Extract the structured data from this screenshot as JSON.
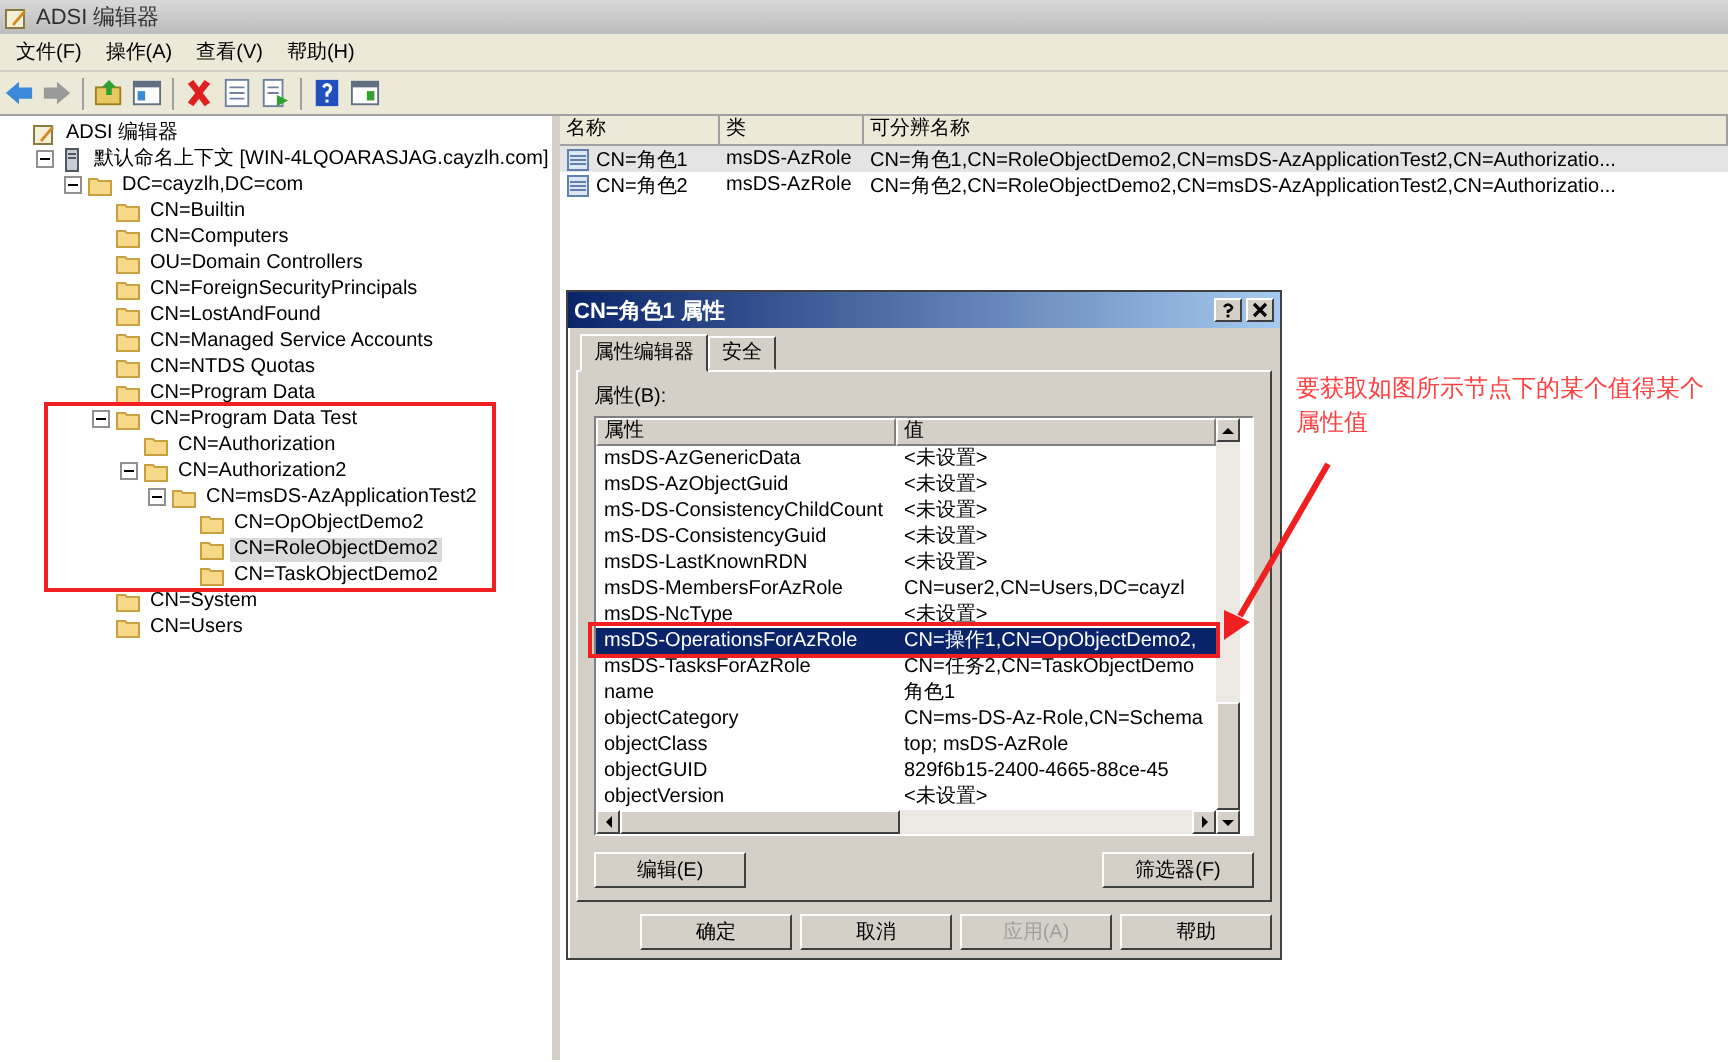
{
  "window": {
    "title": "ADSI 编辑器"
  },
  "menu": [
    "文件(F)",
    "操作(A)",
    "查看(V)",
    "帮助(H)"
  ],
  "tree": [
    {
      "label": "ADSI 编辑器",
      "kind": "root",
      "selected": false,
      "children": [
        {
          "label": "默认命名上下文 [WIN-4LQOARASJAG.cayzlh.com]",
          "kind": "server",
          "selected": false,
          "expanded": true,
          "children": [
            {
              "label": "DC=cayzlh,DC=com",
              "kind": "folder",
              "selected": false,
              "expanded": true,
              "children": [
                {
                  "label": "CN=Builtin",
                  "kind": "folder",
                  "selected": false
                },
                {
                  "label": "CN=Computers",
                  "kind": "folder",
                  "selected": false
                },
                {
                  "label": "OU=Domain Controllers",
                  "kind": "folder",
                  "selected": false
                },
                {
                  "label": "CN=ForeignSecurityPrincipals",
                  "kind": "folder",
                  "selected": false
                },
                {
                  "label": "CN=LostAndFound",
                  "kind": "folder",
                  "selected": false
                },
                {
                  "label": "CN=Managed Service Accounts",
                  "kind": "folder",
                  "selected": false
                },
                {
                  "label": "CN=NTDS Quotas",
                  "kind": "folder",
                  "selected": false
                },
                {
                  "label": "CN=Program Data",
                  "kind": "folder",
                  "selected": false
                },
                {
                  "label": "CN=Program Data Test",
                  "kind": "folder",
                  "selected": false,
                  "expanded": true,
                  "children": [
                    {
                      "label": "CN=Authorization",
                      "kind": "folder",
                      "selected": false
                    },
                    {
                      "label": "CN=Authorization2",
                      "kind": "folder",
                      "selected": false,
                      "expanded": true,
                      "children": [
                        {
                          "label": "CN=msDS-AzApplicationTest2",
                          "kind": "folder",
                          "selected": false,
                          "expanded": true,
                          "children": [
                            {
                              "label": "CN=OpObjectDemo2",
                              "kind": "folder",
                              "selected": false
                            },
                            {
                              "label": "CN=RoleObjectDemo2",
                              "kind": "folder",
                              "selected": true
                            },
                            {
                              "label": "CN=TaskObjectDemo2",
                              "kind": "folder",
                              "selected": false
                            }
                          ]
                        }
                      ]
                    }
                  ]
                },
                {
                  "label": "CN=System",
                  "kind": "folder",
                  "selected": false
                },
                {
                  "label": "CN=Users",
                  "kind": "folder",
                  "selected": false
                }
              ]
            }
          ]
        }
      ]
    }
  ],
  "list": {
    "columns": [
      "名称",
      "类",
      "可分辨名称"
    ],
    "rows": [
      {
        "name": "CN=角色1",
        "class": "msDS-AzRole",
        "dn": "CN=角色1,CN=RoleObjectDemo2,CN=msDS-AzApplicationTest2,CN=Authorizatio...",
        "selected": true
      },
      {
        "name": "CN=角色2",
        "class": "msDS-AzRole",
        "dn": "CN=角色2,CN=RoleObjectDemo2,CN=msDS-AzApplicationTest2,CN=Authorizatio...",
        "selected": false
      }
    ]
  },
  "dialog": {
    "title": "CN=角色1 属性",
    "tabs": [
      {
        "label": "属性编辑器",
        "selected": true
      },
      {
        "label": "安全",
        "selected": false
      }
    ],
    "attributes_label": "属性(B):",
    "columns": [
      "属性",
      "值"
    ],
    "rows": [
      {
        "attribute": "msDS-AzGenericData",
        "value": "<未设置>",
        "selected": false
      },
      {
        "attribute": "msDS-AzObjectGuid",
        "value": "<未设置>",
        "selected": false
      },
      {
        "attribute": "mS-DS-ConsistencyChildCount",
        "value": "<未设置>",
        "selected": false
      },
      {
        "attribute": "mS-DS-ConsistencyGuid",
        "value": "<未设置>",
        "selected": false
      },
      {
        "attribute": "msDS-LastKnownRDN",
        "value": "<未设置>",
        "selected": false
      },
      {
        "attribute": "msDS-MembersForAzRole",
        "value": "CN=user2,CN=Users,DC=cayzl",
        "selected": false
      },
      {
        "attribute": "msDS-NcType",
        "value": "<未设置>",
        "selected": false
      },
      {
        "attribute": "msDS-OperationsForAzRole",
        "value": "CN=操作1,CN=OpObjectDemo2,",
        "selected": true
      },
      {
        "attribute": "msDS-TasksForAzRole",
        "value": "CN=任务2,CN=TaskObjectDemo",
        "selected": false
      },
      {
        "attribute": "name",
        "value": "角色1",
        "selected": false
      },
      {
        "attribute": "objectCategory",
        "value": "CN=ms-DS-Az-Role,CN=Schema",
        "selected": false
      },
      {
        "attribute": "objectClass",
        "value": "top; msDS-AzRole",
        "selected": false
      },
      {
        "attribute": "objectGUID",
        "value": "829f6b15-2400-4665-88ce-45",
        "selected": false
      },
      {
        "attribute": "objectVersion",
        "value": "<未设置>",
        "selected": false
      }
    ],
    "edit_button": "编辑(E)",
    "filter_button": "筛选器(F)",
    "buttons": [
      {
        "label": "确定",
        "disabled": false
      },
      {
        "label": "取消",
        "disabled": false
      },
      {
        "label": "应用(A)",
        "disabled": true
      },
      {
        "label": "帮助",
        "disabled": false
      }
    ]
  },
  "annotation": {
    "note": "要获取如图所示节点下的某个值得某个属性值"
  }
}
